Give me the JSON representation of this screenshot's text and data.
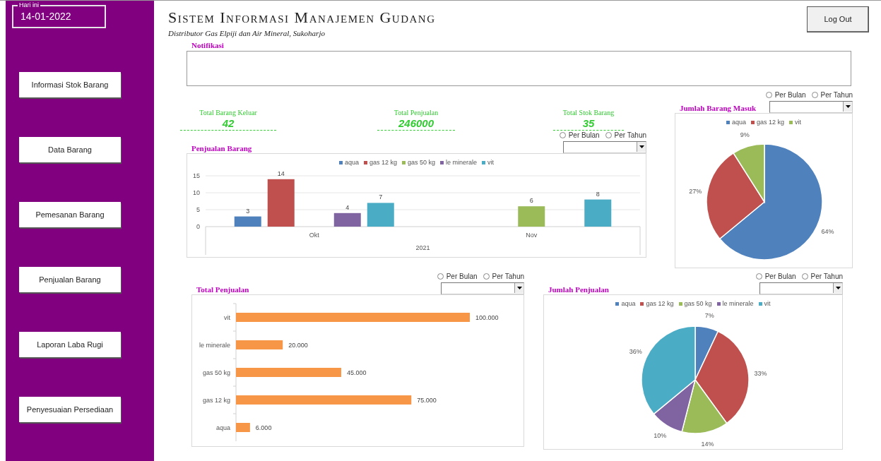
{
  "sidebar": {
    "date_box": {
      "legend": "Hari ini",
      "value": "14-01-2022"
    },
    "items": [
      {
        "label": "Informasi Stok Barang"
      },
      {
        "label": "Data Barang"
      },
      {
        "label": "Pemesanan Barang"
      },
      {
        "label": "Penjualan Barang"
      },
      {
        "label": "Laporan Laba Rugi"
      },
      {
        "label": "Penyesuaian Persediaan"
      }
    ]
  },
  "header": {
    "title": "Sistem Informasi Manajemen Gudang",
    "subtitle": "Distributor Gas Elpiji dan Air Mineral, Sukoharjo",
    "logout_button": "Log Out"
  },
  "notification": {
    "label": "Notifikasi"
  },
  "stats": [
    {
      "label": "Total Barang Keluar",
      "value": "42"
    },
    {
      "label": "Total Penjualan",
      "value": "246000"
    },
    {
      "label": "Total Stok Barang",
      "value": "35"
    }
  ],
  "panels": [
    {
      "title": "Penjualan Barang",
      "filter": {
        "options": [
          {
            "label": "Per Bulan",
            "selected": false
          },
          {
            "label": "Per Tahun",
            "selected": false
          }
        ]
      },
      "chart_data": {
        "type": "bar",
        "legend": "top",
        "categories": [
          "Okt",
          "Nov"
        ],
        "xlabel": "2021",
        "ylim": [
          0,
          15
        ],
        "yticks": [
          0,
          5,
          10,
          15
        ],
        "data_labels": true,
        "series": [
          {
            "name": "aqua",
            "color": "#4f81bd",
            "values": [
              3,
              null
            ]
          },
          {
            "name": "gas 12 kg",
            "color": "#c0504d",
            "values": [
              14,
              null
            ]
          },
          {
            "name": "gas 50 kg",
            "color": "#9bbb59",
            "values": [
              null,
              6
            ]
          },
          {
            "name": "le minerale",
            "color": "#8064a2",
            "values": [
              4,
              null
            ]
          },
          {
            "name": "vit",
            "color": "#4bacc6",
            "values": [
              7,
              8
            ]
          }
        ]
      }
    },
    {
      "title": "Jumlah Barang Masuk",
      "filter": {
        "options": [
          {
            "label": "Per Bulan",
            "selected": false
          },
          {
            "label": "Per Tahun",
            "selected": false
          }
        ]
      },
      "chart_data": {
        "type": "pie",
        "legend": "top",
        "categories": [
          "aqua",
          "gas 12 kg",
          "vit"
        ],
        "colors": [
          "#4f81bd",
          "#c0504d",
          "#9bbb59"
        ],
        "values": [
          64,
          27,
          9
        ],
        "value_labels": [
          "64%",
          "27%",
          "9%"
        ]
      }
    },
    {
      "title": "Total Penjualan",
      "filter": {
        "options": [
          {
            "label": "Per Bulan",
            "selected": false
          },
          {
            "label": "Per Tahun",
            "selected": false
          }
        ]
      },
      "chart_data": {
        "type": "bar",
        "orientation": "horizontal",
        "categories": [
          "vit",
          "le minerale",
          "gas 50 kg",
          "gas 12 kg",
          "aqua"
        ],
        "color": "#f79646",
        "values": [
          100000,
          20000,
          45000,
          75000,
          6000
        ],
        "data_labels": true,
        "value_labels": [
          "100.000",
          "20.000",
          "45.000",
          "75.000",
          "6.000"
        ]
      }
    },
    {
      "title": "Jumlah Penjualan",
      "filter": {
        "options": [
          {
            "label": "Per Bulan",
            "selected": false
          },
          {
            "label": "Per Tahun",
            "selected": false
          }
        ]
      },
      "chart_data": {
        "type": "pie",
        "legend": "top",
        "categories": [
          "aqua",
          "gas 12 kg",
          "gas 50 kg",
          "le minerale",
          "vit"
        ],
        "colors": [
          "#4f81bd",
          "#c0504d",
          "#9bbb59",
          "#8064a2",
          "#4bacc6"
        ],
        "values": [
          7,
          33,
          14,
          10,
          36
        ],
        "value_labels": [
          "7%",
          "33%",
          "14%",
          "10%",
          "36%"
        ]
      }
    }
  ]
}
